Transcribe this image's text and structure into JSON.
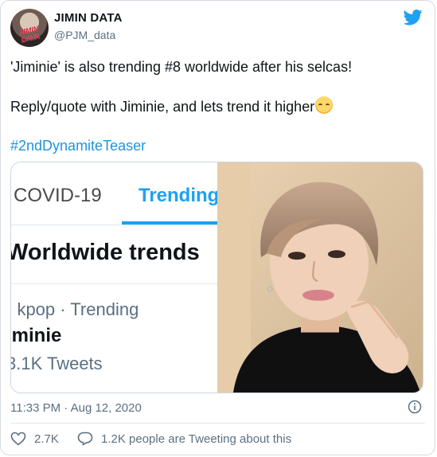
{
  "author": {
    "name": "JIMIN DATA",
    "handle": "@PJM_data",
    "avatar_logo": "JIMIN DATA",
    "avatar_icon": "avatar"
  },
  "tweet": {
    "line1": "'Jiminie' is also trending #8 worldwide after his selcas!",
    "line2": "Reply/quote with Jiminie, and lets trend it higher",
    "emoji": "smiling-face-with-blush",
    "hashtag": "#2ndDynamiteTeaser"
  },
  "media": {
    "screenshot": {
      "tab_covid": "COVID-19",
      "tab_trending": "Trending",
      "section_title": "Worldwide trends",
      "trend_meta": "· kpop · Trending",
      "trend_name": "iminie",
      "tweet_count": "3.1K Tweets"
    },
    "photo_icon": "photo"
  },
  "footer": {
    "timestamp": "11:33 PM · Aug 12, 2020",
    "likes": "2.7K",
    "conversation": "1.2K people are Tweeting about this"
  },
  "colors": {
    "twitter_blue": "#1da1f2",
    "link_blue": "#1b95e0",
    "muted": "#5b7083"
  }
}
